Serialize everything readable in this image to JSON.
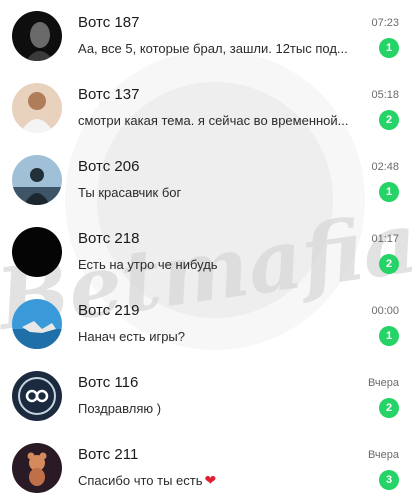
{
  "chats": [
    {
      "name": "Вотс 187",
      "time": "07:23",
      "preview": "Аа, все 5, которые брал, зашли. 12тыс под...",
      "unread": "1"
    },
    {
      "name": "Вотс 137",
      "time": "05:18",
      "preview": "смотри какая тема. я сейчас во временной...",
      "unread": "2"
    },
    {
      "name": "Вотс 206",
      "time": "02:48",
      "preview": "Ты красавчик бог",
      "unread": "1"
    },
    {
      "name": "Вотс 218",
      "time": "01:17",
      "preview": "Есть на утро че нибудь",
      "unread": "2"
    },
    {
      "name": "Вотс 219",
      "time": "00:00",
      "preview": "Нанач есть игры?",
      "unread": "1"
    },
    {
      "name": "Вотс 116",
      "time": "Вчера",
      "preview": "Поздравляю )",
      "unread": "2"
    },
    {
      "name": "Вотс 211",
      "time": "Вчера",
      "preview": "Спасибо что ты есть",
      "unread": "3"
    }
  ],
  "watermark": {
    "text": "Betmafia"
  },
  "colors": {
    "badge": "#25d366",
    "heart": "#e0202f"
  },
  "icons": {
    "heart": "heart-emoji-icon"
  }
}
